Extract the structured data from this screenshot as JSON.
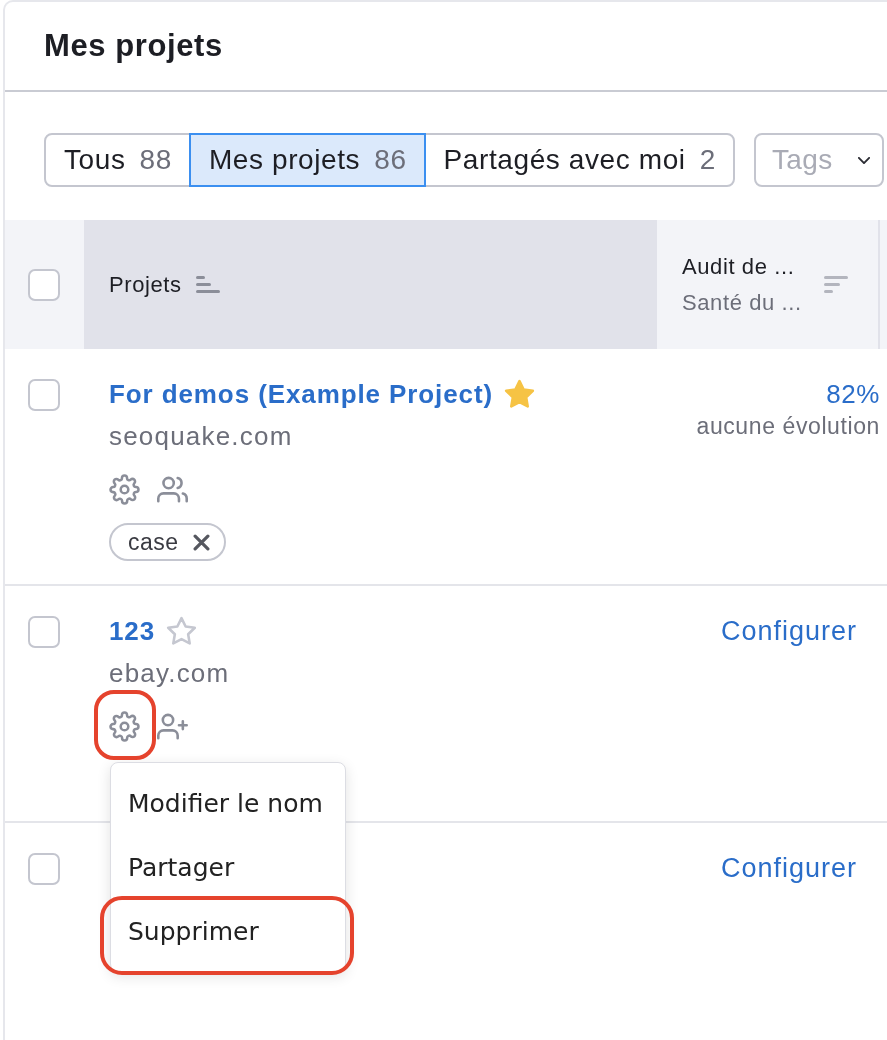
{
  "page": {
    "title": "Mes projets"
  },
  "filter_tabs": [
    {
      "label": "Tous",
      "count": "88",
      "selected": false
    },
    {
      "label": "Mes projets",
      "count": "86",
      "selected": true
    },
    {
      "label": "Partagés avec moi",
      "count": "2",
      "selected": false
    }
  ],
  "tags_select": {
    "placeholder": "Tags"
  },
  "table": {
    "select_all": {
      "checked": false
    },
    "columns": [
      {
        "label": "Projets",
        "sorted": true
      },
      {
        "label": "Audit de ...",
        "sublabel": "Santé du ...",
        "sorted": false
      }
    ],
    "rows": [
      {
        "checked": false,
        "name": "For demos (Example Project)",
        "favorite": true,
        "domain": "seoquake.com",
        "shared": true,
        "settings_highlighted": false,
        "tags": [
          {
            "label": "case"
          }
        ],
        "audit": {
          "kind": "score",
          "value": "82%",
          "note": "aucune évolution"
        }
      },
      {
        "checked": false,
        "name": "123",
        "favorite": false,
        "domain": "ebay.com",
        "shared": false,
        "settings_highlighted": true,
        "audit": {
          "kind": "link",
          "label": "Configurer"
        },
        "settings_menu": {
          "items": [
            {
              "label": "Modifier le nom",
              "highlighted": false
            },
            {
              "label": "Partager",
              "highlighted": false
            },
            {
              "label": "Supprimer",
              "highlighted": true
            }
          ]
        }
      },
      {
        "checked": false,
        "audit": {
          "kind": "link",
          "label": "Configurer"
        }
      }
    ]
  }
}
